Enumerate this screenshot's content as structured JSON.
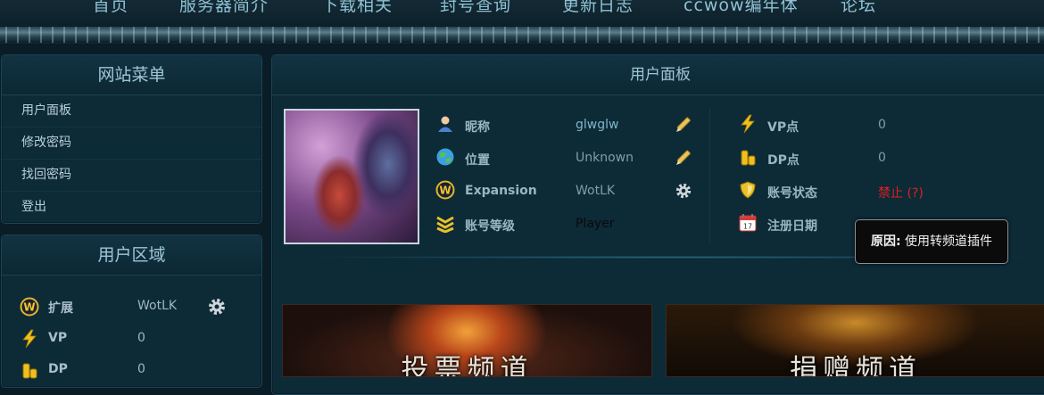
{
  "nav": {
    "items": [
      "首页",
      "服务器简介",
      "下载相关",
      "封号查询",
      "更新日志",
      "ccwow编年体",
      "论坛"
    ]
  },
  "site_menu": {
    "title": "网站菜单",
    "items": [
      "用户面板",
      "修改密码",
      "找回密码",
      "登出"
    ]
  },
  "user_area": {
    "title": "用户区域",
    "rows": [
      {
        "label": "扩展",
        "value": "WotLK",
        "icon": "wotlk-icon"
      },
      {
        "label": "VP",
        "value": "0",
        "icon": "lightning-icon"
      },
      {
        "label": "DP",
        "value": "0",
        "icon": "coins-icon"
      }
    ]
  },
  "user_panel": {
    "title": "用户面板",
    "left_rows": [
      {
        "label": "昵称",
        "value": "glwglw",
        "icon": "user-icon",
        "action": "edit-icon"
      },
      {
        "label": "位置",
        "value": "Unknown",
        "icon": "globe-icon",
        "action": "edit-icon"
      },
      {
        "label": "Expansion",
        "value": "WotLK",
        "icon": "wotlk-icon",
        "action": "gear-icon"
      },
      {
        "label": "账号等级",
        "value": "Player",
        "icon": "rank-icon"
      }
    ],
    "right_rows": [
      {
        "label": "VP点",
        "value": "0",
        "icon": "lightning-icon"
      },
      {
        "label": "DP点",
        "value": "0",
        "icon": "coins-icon"
      },
      {
        "label": "账号状态",
        "value": "禁止 (?)",
        "icon": "shield-icon"
      },
      {
        "label": "注册日期",
        "value": "",
        "icon": "calendar-icon"
      }
    ]
  },
  "tooltip": {
    "label": "原因:",
    "text": "使用转频道插件"
  },
  "banners": {
    "vote": "投票频道",
    "donate": "捐赠频道"
  },
  "colors": {
    "link": "#7fb5c9",
    "banned": "#e02020",
    "background": "#0a1c26"
  }
}
